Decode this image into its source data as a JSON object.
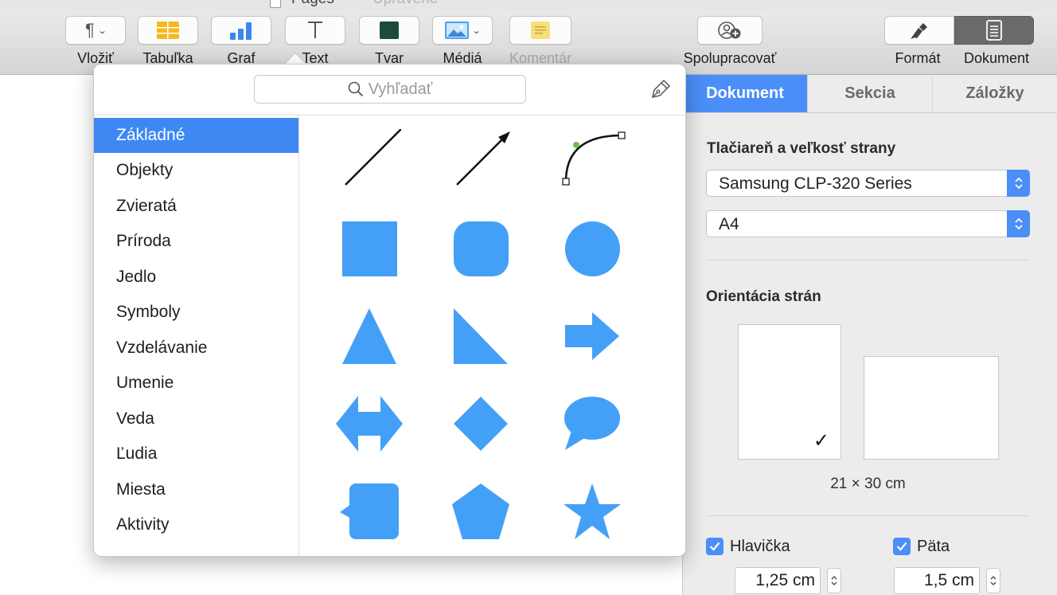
{
  "window": {
    "app_name": "Pages",
    "state": "Upravené"
  },
  "toolbar": {
    "insert": {
      "label": "Vložiť",
      "icon": "paragraph-icon"
    },
    "table": {
      "label": "Tabuľka",
      "icon": "table-icon"
    },
    "chart": {
      "label": "Graf",
      "icon": "bar-chart-icon"
    },
    "text": {
      "label": "Text",
      "icon": "text-box-icon"
    },
    "shape": {
      "label": "Tvar",
      "icon": "shape-square-icon"
    },
    "media": {
      "label": "Médiá",
      "icon": "image-icon"
    },
    "comment": {
      "label": "Komentár",
      "icon": "note-icon"
    },
    "collaborate": {
      "label": "Spolupracovať",
      "icon": "collaborate-icon"
    },
    "format": {
      "label": "Formát",
      "icon": "paintbrush-icon"
    },
    "document": {
      "label": "Dokument",
      "icon": "document-icon"
    }
  },
  "shape_popover": {
    "search_placeholder": "Vyhľadať",
    "categories": [
      {
        "label": "Základné",
        "selected": true
      },
      {
        "label": "Objekty"
      },
      {
        "label": "Zvieratá"
      },
      {
        "label": "Príroda"
      },
      {
        "label": "Jedlo"
      },
      {
        "label": "Symboly"
      },
      {
        "label": "Vzdelávanie"
      },
      {
        "label": "Umenie"
      },
      {
        "label": "Veda"
      },
      {
        "label": "Ľudia"
      },
      {
        "label": "Miesta"
      },
      {
        "label": "Aktivity"
      }
    ],
    "shape_color": "#44a0f7",
    "shapes": [
      "line",
      "arrow-line",
      "curve",
      "square",
      "rounded-square",
      "circle",
      "triangle",
      "right-triangle",
      "arrow",
      "double-arrow",
      "diamond",
      "speech-bubble",
      "callout",
      "pentagon",
      "star"
    ]
  },
  "inspector": {
    "tabs": [
      "Dokument",
      "Sekcia",
      "Záložky"
    ],
    "active_tab": "Dokument",
    "printer_section_title": "Tlačiareň a veľkosť strany",
    "printer": "Samsung CLP-320 Series",
    "paper_size": "A4",
    "orientation_title": "Orientácia strán",
    "page_dimensions": "21 × 30 cm",
    "header_label": "Hlavička",
    "header_checked": true,
    "header_value": "1,25 cm",
    "footer_label": "Päta",
    "footer_checked": true,
    "footer_value": "1,5 cm",
    "accent_color": "#4b8ef7"
  }
}
